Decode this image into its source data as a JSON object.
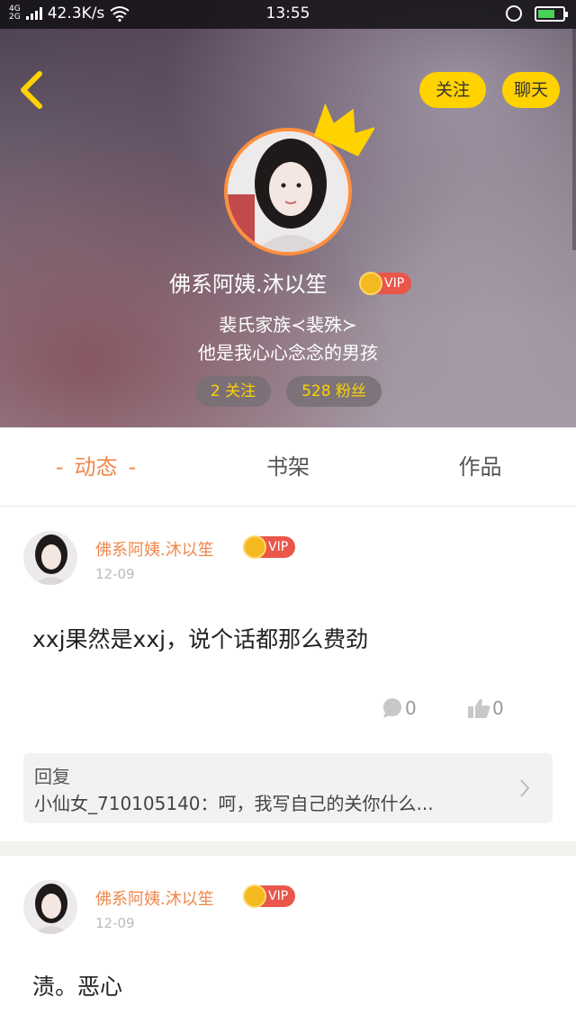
{
  "statusbar": {
    "network": "4G",
    "network2": "2G",
    "speed": "42.3K/s",
    "time": "13:55"
  },
  "header": {
    "follow_label": "关注",
    "chat_label": "聊天",
    "username": "佛系阿姨.沐以笙",
    "vip_label": "VIP",
    "bio_line1": "裴氏家族≺裴殊≻",
    "bio_line2": "他是我心心念念的男孩",
    "following": "2 关注",
    "fans": "528 粉丝"
  },
  "tabs": {
    "dynamic": "动态",
    "dash": "-",
    "bookshelf": "书架",
    "works": "作品"
  },
  "posts": [
    {
      "username": "佛系阿姨.沐以笙",
      "vip": "VIP",
      "date": "12-09",
      "content": "xxj果然是xxj，说个话都那么费劲",
      "comments": "0",
      "likes": "0",
      "reply_label": "回复",
      "reply_text": "小仙女_710105140：呵，我写自己的关你什么..."
    },
    {
      "username": "佛系阿姨.沐以笙",
      "vip": "VIP",
      "date": "12-09",
      "content": "渍。恶心"
    }
  ],
  "colors": {
    "accent": "#f0874b",
    "yellow": "#ffd200",
    "vip_red": "#e9564a"
  }
}
